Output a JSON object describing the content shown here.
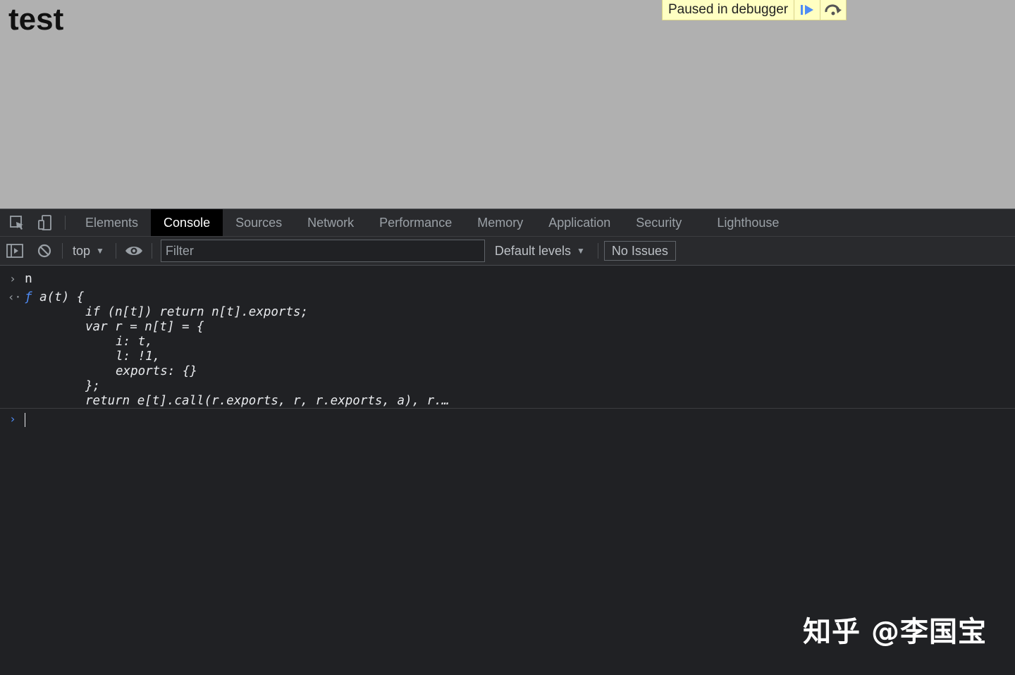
{
  "page": {
    "heading": "test",
    "debugger_banner": {
      "text": "Paused in debugger",
      "resume_icon": "resume-play-icon",
      "step_icon": "step-over-icon"
    }
  },
  "devtools": {
    "tabs": [
      "Elements",
      "Console",
      "Sources",
      "Network",
      "Performance",
      "Memory",
      "Application",
      "Security",
      "Lighthouse"
    ],
    "active_tab": "Console",
    "toolbar": {
      "context": "top",
      "filter_placeholder": "Filter",
      "levels": "Default levels",
      "issues": "No Issues"
    },
    "console": {
      "input_command": "n",
      "result_lines": [
        {
          "prefix": "ƒ",
          "text": " a(t) {"
        },
        {
          "text": "if (n[t]) return n[t].exports;"
        },
        {
          "text": "var r = n[t] = {"
        },
        {
          "text": "i: t,"
        },
        {
          "text": "l: !1,"
        },
        {
          "text": "exports: {}"
        },
        {
          "text": "};"
        },
        {
          "text": "return e[t].call(r.exports, r, r.exports, a), r.…"
        }
      ]
    }
  },
  "watermark": "知乎 @李国宝",
  "colors": {
    "page_bg": "#b0b0b0",
    "banner_bg": "#ffffc2",
    "devtools_bg": "#202124",
    "accent_blue": "#4f8cf5"
  }
}
